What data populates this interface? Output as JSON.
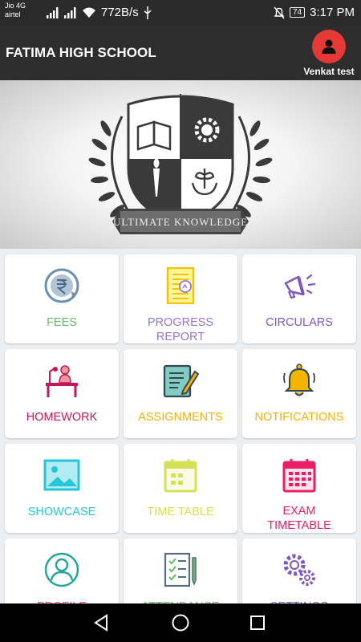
{
  "status_bar": {
    "carrier_1": "Jio 4G",
    "carrier_2": "airtel",
    "speed": "772B/s",
    "battery": "74",
    "time": "3:17 PM"
  },
  "app_bar": {
    "school_name": "FATIMA HIGH SCHOOL",
    "user_name": "Venkat test",
    "avatar_icon": "person-icon",
    "avatar_color": "#e53935"
  },
  "banner": {
    "motto": "ULTIMATE KNOWLEDGE",
    "icons": [
      "open-book-icon",
      "gear-icon",
      "torch-icon",
      "plant-in-hands-icon",
      "laurel-wreath-icon"
    ]
  },
  "tiles": [
    {
      "label": "FEES",
      "icon": "rupee-coin-icon",
      "color": "#66bb6a"
    },
    {
      "label": "PROGRESS REPORT",
      "label_lines": [
        "PROGRESS",
        "REPORT"
      ],
      "icon": "report-sheet-icon",
      "color": "#9575cd"
    },
    {
      "label": "CIRCULARS",
      "icon": "megaphone-icon",
      "color": "#7e57c2"
    },
    {
      "label": "HOMEWORK",
      "icon": "study-desk-icon",
      "color": "#c2185b"
    },
    {
      "label": "ASSIGNMENTS",
      "icon": "notepad-pencil-icon",
      "color": "#f4b400"
    },
    {
      "label": "NOTIFICATIONS",
      "icon": "bell-icon",
      "color": "#f4b400"
    },
    {
      "label": "SHOWCASE",
      "icon": "picture-icon",
      "color": "#26c6da"
    },
    {
      "label": "TIME TABLE",
      "icon": "calendar-icon",
      "color": "#d4e157"
    },
    {
      "label": "EXAM TIMETABLE",
      "label_lines": [
        "EXAM",
        "TIMETABLE"
      ],
      "icon": "exam-calendar-icon",
      "color": "#e91e63"
    },
    {
      "label": "PROFILE",
      "icon": "profile-icon",
      "color": "#ec407a"
    },
    {
      "label": "ATTENDANCE",
      "icon": "checklist-icon",
      "color": "#66bb6a"
    },
    {
      "label": "SETTINGS",
      "icon": "gears-icon",
      "color": "#7e57c2"
    }
  ],
  "nav_bar": {
    "back": "back-triangle-icon",
    "home": "home-circle-icon",
    "recents": "recents-square-icon"
  }
}
